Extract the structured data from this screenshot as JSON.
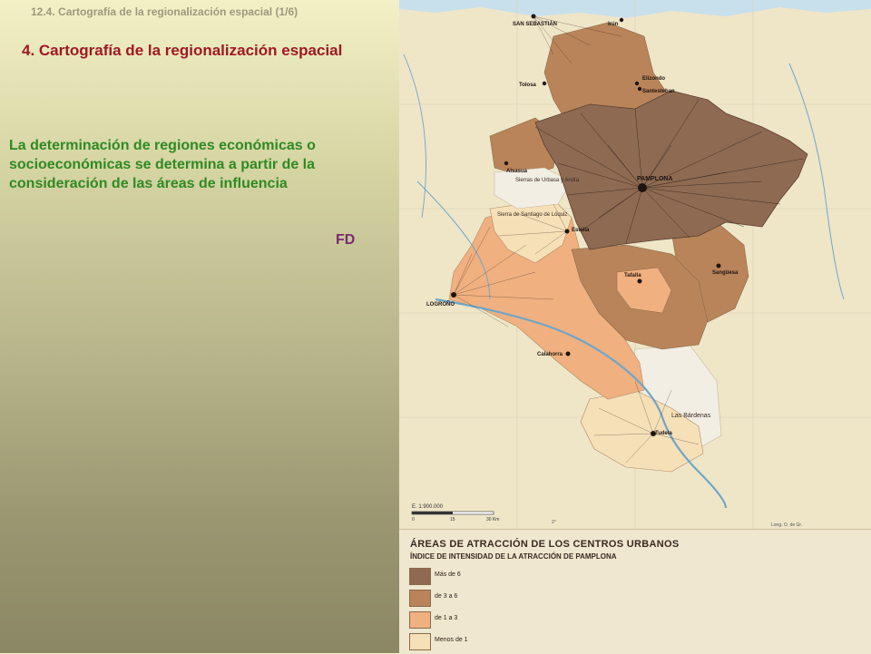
{
  "slide": {
    "header": "12.4. Cartografía  de la regionalización espacial (1/6)",
    "title": "4. Cartografía de la regionalización espacial",
    "body": "La determinación de regiones económicas o socioeconómicas se determina a partir de la consideración de las áreas de influencia",
    "tag": "FD"
  },
  "map": {
    "cities": [
      "SAN SEBASTIÁN",
      "Irún",
      "Tolosa",
      "Elizondo",
      "Santesteban",
      "Alsasua",
      "PAMPLONA",
      "Estella",
      "Tafalla",
      "Sangüesa",
      "LOGROÑO",
      "Calahorra",
      "Tudela"
    ],
    "areas": [
      "Sierras de Urbasa y Andía",
      "Sierra de Santiago de Lóquiz",
      "Las Bárdenas"
    ],
    "scale_text": "E. 1:900.000",
    "scale_ticks": [
      "0",
      "15",
      "30 Km"
    ],
    "grid_labels": [
      "2°",
      "Long. O. de Gr."
    ]
  },
  "legend": {
    "title": "ÁREAS DE ATRACCIÓN DE LOS CENTROS URBANOS",
    "subtitle": "ÍNDICE DE INTENSIDAD DE LA ATRACCIÓN DE PAMPLONA",
    "items": [
      {
        "label": "Más de 6",
        "color": "#8e6a52"
      },
      {
        "label": "de 3 a 6",
        "color": "#b9845a"
      },
      {
        "label": "de 1 a 3",
        "color": "#f0b080"
      },
      {
        "label": "Menos de 1",
        "color": "#f6e0b8"
      }
    ]
  },
  "colors": {
    "title": "#a01824",
    "body": "#2f8a22",
    "tag": "#7a2a6e",
    "sea": "#c8e0ec",
    "river": "#6fa6c8"
  }
}
